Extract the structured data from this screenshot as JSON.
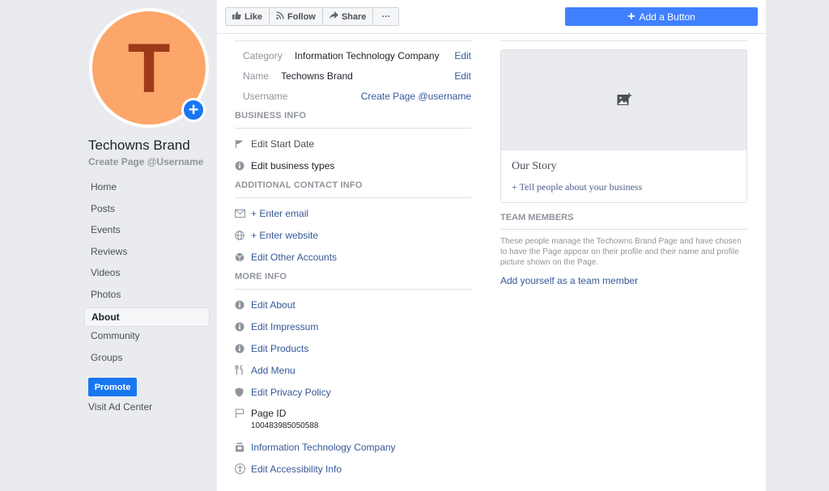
{
  "profile": {
    "avatar_letter": "T",
    "page_name": "Techowns Brand",
    "username_cta": "Create Page @Username",
    "colors": {
      "avatar_bg": "#fca66a",
      "avatar_letter": "#9d3a1a",
      "accent": "#1877f2"
    }
  },
  "nav": {
    "items": [
      {
        "label": "Home"
      },
      {
        "label": "Posts"
      },
      {
        "label": "Events"
      },
      {
        "label": "Reviews"
      },
      {
        "label": "Videos"
      },
      {
        "label": "Photos"
      },
      {
        "label": "About",
        "active": true
      },
      {
        "label": "Community"
      },
      {
        "label": "Groups"
      }
    ],
    "promote_label": "Promote",
    "ad_center_label": "Visit Ad Center"
  },
  "toolbar": {
    "like_label": "Like",
    "follow_label": "Follow",
    "share_label": "Share",
    "more_label": "···",
    "add_button_label": "Add a Button"
  },
  "general": {
    "category_label": "Category",
    "category_value": "Information Technology Company",
    "name_label": "Name",
    "name_value": "Techowns Brand",
    "username_label": "Username",
    "username_link": "Create Page @username",
    "edit_label": "Edit"
  },
  "business_info": {
    "heading": "BUSINESS INFO",
    "items": [
      {
        "icon": "flag-icon",
        "label": "Edit Start Date"
      },
      {
        "icon": "info-icon",
        "label": "Edit business types"
      }
    ]
  },
  "contact_info": {
    "heading": "ADDITIONAL CONTACT INFO",
    "items": [
      {
        "icon": "envelope-icon",
        "label": "+ Enter email"
      },
      {
        "icon": "globe-icon",
        "label": "+ Enter website"
      },
      {
        "icon": "cube-icon",
        "label": "Edit Other Accounts"
      }
    ]
  },
  "more_info": {
    "heading": "MORE INFO",
    "items": [
      {
        "icon": "info-icon",
        "label": "Edit About"
      },
      {
        "icon": "info-icon",
        "label": "Edit Impressum"
      },
      {
        "icon": "info-icon",
        "label": "Edit Products"
      },
      {
        "icon": "utensils-icon",
        "label": "Add Menu"
      },
      {
        "icon": "shield-icon",
        "label": "Edit Privacy Policy"
      }
    ],
    "page_id_label": "Page ID",
    "page_id_value": "100483985050588",
    "category_item": "Information Technology Company",
    "accessibility_item": "Edit Accessibility Info"
  },
  "story": {
    "title": "Our Story",
    "link": "+ Tell people about your business"
  },
  "team": {
    "heading": "TEAM MEMBERS",
    "description": "These people manage the Techowns Brand Page and have chosen to have the Page appear on their profile and their name and profile picture shown on the Page.",
    "add_link": "Add yourself as a team member"
  }
}
